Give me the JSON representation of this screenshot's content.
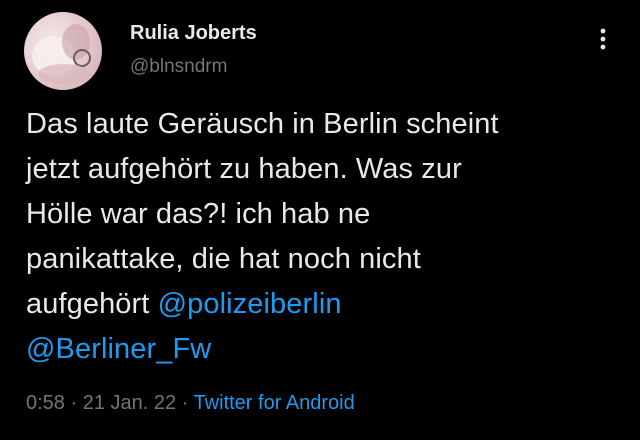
{
  "user": {
    "display_name": "Rulia Joberts",
    "handle": "@blnsndrm"
  },
  "tweet": {
    "lines": [
      "Das laute Geräusch in Berlin scheint",
      "jetzt aufgehört zu haben. Was zur",
      "Hölle war das?! ich hab ne",
      "panikattake, die hat noch nicht",
      "aufgehört "
    ],
    "mention_1": "@polizeiberlin",
    "mention_2": "@Berliner_Fw"
  },
  "meta": {
    "time": "0:58",
    "separator": " · ",
    "date": "21 Jan. 22",
    "source": "Twitter for Android"
  },
  "icons": {
    "more": "more-vertical-icon"
  },
  "colors": {
    "background": "#000000",
    "text": "#e7e9ea",
    "secondary": "#71767b",
    "link": "#1d9bf0"
  }
}
